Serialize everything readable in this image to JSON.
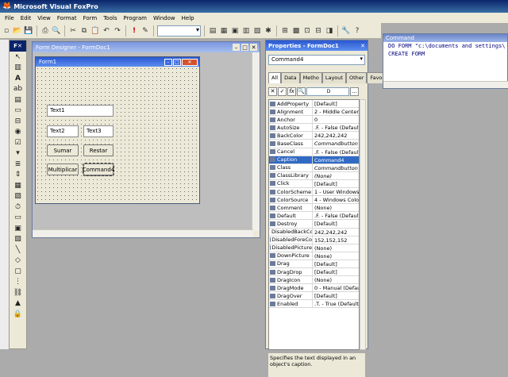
{
  "app": {
    "title": "Microsoft Visual FoxPro"
  },
  "menu": [
    "File",
    "Edit",
    "View",
    "Format",
    "Form",
    "Tools",
    "Program",
    "Window",
    "Help"
  ],
  "form_designer": {
    "title": "Form Designer - FormDoc1",
    "form_title": "Form1",
    "controls": {
      "text1": "Text1",
      "text2": "Text2",
      "text3": "Text3",
      "sumar": "Sumar",
      "restar": "Restar",
      "multiplicar": "Multiplicar",
      "command4": "Command4"
    }
  },
  "properties": {
    "title": "Properties - FormDoc1",
    "object": "Command4",
    "tabs": [
      "All",
      "Data",
      "Metho",
      "Layout",
      "Other",
      "Favori"
    ],
    "filter_value": "D",
    "rows": [
      {
        "name": "AddProperty",
        "value": "[Default]",
        "italic": false
      },
      {
        "name": "Alignment",
        "value": "2 - Middle Center (D",
        "italic": false
      },
      {
        "name": "Anchor",
        "value": "0",
        "italic": false
      },
      {
        "name": "AutoSize",
        "value": ".F. - False (Default)",
        "italic": false
      },
      {
        "name": "BackColor",
        "value": "242,242,242",
        "italic": false
      },
      {
        "name": "BaseClass",
        "value": "Commandbutton",
        "italic": true
      },
      {
        "name": "Cancel",
        "value": ".F. - False (Default)",
        "italic": false
      },
      {
        "name": "Caption",
        "value": "Command4",
        "italic": false,
        "selected": true
      },
      {
        "name": "Class",
        "value": "Commandbutton",
        "italic": true
      },
      {
        "name": "ClassLibrary",
        "value": "(None)",
        "italic": true
      },
      {
        "name": "Click",
        "value": "[Default]",
        "italic": false
      },
      {
        "name": "ColorScheme",
        "value": "1 - User Windows",
        "italic": false
      },
      {
        "name": "ColorSource",
        "value": "4 - Windows Colors",
        "italic": false
      },
      {
        "name": "Comment",
        "value": "(None)",
        "italic": false
      },
      {
        "name": "Default",
        "value": ".F. - False (Default)",
        "italic": false
      },
      {
        "name": "Destroy",
        "value": "[Default]",
        "italic": false
      },
      {
        "name": "DisabledBackCo",
        "value": "242,242,242",
        "italic": false
      },
      {
        "name": "DisabledForeCo",
        "value": "152,152,152",
        "italic": false
      },
      {
        "name": "DisabledPicture",
        "value": "(None)",
        "italic": false
      },
      {
        "name": "DownPicture",
        "value": "(None)",
        "italic": false
      },
      {
        "name": "Drag",
        "value": "[Default]",
        "italic": false
      },
      {
        "name": "DragDrop",
        "value": "[Default]",
        "italic": false
      },
      {
        "name": "DragIcon",
        "value": "(None)",
        "italic": false
      },
      {
        "name": "DragMode",
        "value": "0 - Manual (Default)",
        "italic": false
      },
      {
        "name": "DragOver",
        "value": "[Default]",
        "italic": false
      },
      {
        "name": "Enabled",
        "value": ".T. - True (Default)",
        "italic": false
      }
    ],
    "description": "Specifies the text displayed in an object's caption."
  },
  "command_window": {
    "title": "Command",
    "lines": [
      "DO FORM \"c:\\documents and settings\\",
      "CREATE FORM"
    ]
  },
  "colors": {
    "title_blue": "#0a246a",
    "selected_row": "#316ac5",
    "command_text": "#000080"
  }
}
